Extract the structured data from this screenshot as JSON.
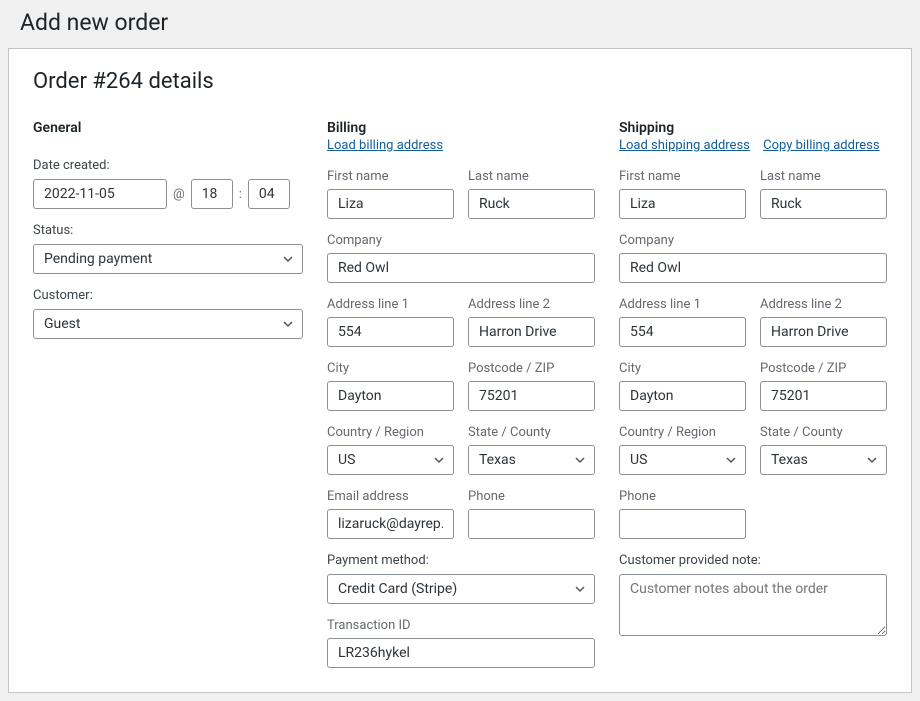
{
  "page_header": "Add new order",
  "order_title": "Order #264 details",
  "general": {
    "heading": "General",
    "date_created_label": "Date created:",
    "date": "2022-11-05",
    "at_symbol": "@",
    "hour": "18",
    "colon": ":",
    "minute": "04",
    "status_label": "Status:",
    "status_value": "Pending payment",
    "customer_label": "Customer:",
    "customer_value": "Guest"
  },
  "billing": {
    "heading": "Billing",
    "load_link": "Load billing address",
    "first_name_label": "First name",
    "first_name": "Liza",
    "last_name_label": "Last name",
    "last_name": "Ruck",
    "company_label": "Company",
    "company": "Red Owl",
    "address1_label": "Address line 1",
    "address1": "554",
    "address2_label": "Address line 2",
    "address2": "Harron Drive",
    "city_label": "City",
    "city": "Dayton",
    "postcode_label": "Postcode / ZIP",
    "postcode": "75201",
    "country_label": "Country / Region",
    "country": "US",
    "state_label": "State / County",
    "state": "Texas",
    "email_label": "Email address",
    "email": "lizaruck@dayrep.com",
    "phone_label": "Phone",
    "phone": "",
    "payment_label": "Payment method:",
    "payment": "Credit Card (Stripe)",
    "transaction_label": "Transaction ID",
    "transaction": "LR236hykel"
  },
  "shipping": {
    "heading": "Shipping",
    "load_link": "Load shipping address",
    "copy_link": "Copy billing address",
    "first_name_label": "First name",
    "first_name": "Liza",
    "last_name_label": "Last name",
    "last_name": "Ruck",
    "company_label": "Company",
    "company": "Red Owl",
    "address1_label": "Address line 1",
    "address1": "554",
    "address2_label": "Address line 2",
    "address2": "Harron Drive",
    "city_label": "City",
    "city": "Dayton",
    "postcode_label": "Postcode / ZIP",
    "postcode": "75201",
    "country_label": "Country / Region",
    "country": "US",
    "state_label": "State / County",
    "state": "Texas",
    "phone_label": "Phone",
    "phone": "",
    "note_label": "Customer provided note:",
    "note_placeholder": "Customer notes about the order",
    "note_value": ""
  }
}
